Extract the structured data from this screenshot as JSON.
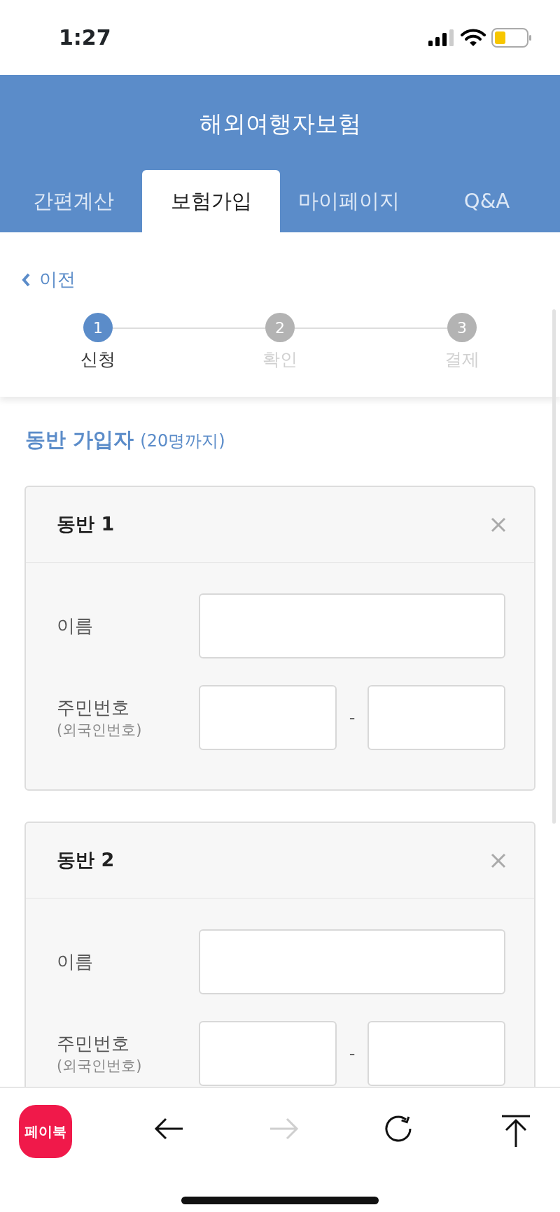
{
  "status_bar": {
    "time": "1:27"
  },
  "header": {
    "title": "해외여행자보험"
  },
  "tabs": [
    {
      "label": "간편계산",
      "selected": false
    },
    {
      "label": "보험가입",
      "selected": true
    },
    {
      "label": "마이페이지",
      "selected": false
    },
    {
      "label": "Q&A",
      "selected": false
    }
  ],
  "back_link": {
    "label": "이전"
  },
  "steps": [
    {
      "number": "1",
      "label": "신청",
      "selected": true
    },
    {
      "number": "2",
      "label": "확인",
      "selected": false
    },
    {
      "number": "3",
      "label": "결제",
      "selected": false
    }
  ],
  "section": {
    "title": "동반 가입자",
    "note": "(20명까지)"
  },
  "companions": [
    {
      "title": "동반 1",
      "name_label": "이름",
      "id_label": "주민번호",
      "id_sublabel": "(외국인번호)",
      "separator": "-"
    },
    {
      "title": "동반 2",
      "name_label": "이름",
      "id_label": "주민번호",
      "id_sublabel": "(외국인번호)",
      "separator": "-"
    }
  ],
  "toolbar": {
    "app_badge": "페이북",
    "buttons": [
      {
        "kind": "back",
        "disabled": false
      },
      {
        "kind": "forward",
        "disabled": true
      },
      {
        "kind": "reload",
        "disabled": false
      },
      {
        "kind": "top",
        "disabled": false
      }
    ]
  }
}
